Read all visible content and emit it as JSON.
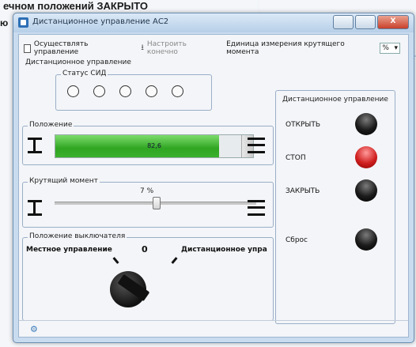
{
  "background": {
    "text": "ечном положений ЗАКРЫТО",
    "text2": "ю"
  },
  "window": {
    "title": "Дистанционное управление АС2",
    "minimize": "",
    "maximize": "",
    "close": "X"
  },
  "toolbar": {
    "connect_label": "Осуществлять управление",
    "configure_label": "Настроить конечно",
    "unit_label": "Единица измерения крутящего момента",
    "unit_value": "%"
  },
  "remote_section_label": "Дистанционное управление",
  "led_status": {
    "label": "Статус СИД",
    "count": 5
  },
  "position": {
    "label": "Положение",
    "value": "82,6",
    "fill_percent": 82.6
  },
  "torque": {
    "label": "Крутящий момент",
    "value": "7 %",
    "slider_percent": 50
  },
  "switch": {
    "label": "Положение выключателя",
    "local": "Местное управление",
    "zero": "0",
    "remote": "Дистанционное упра"
  },
  "right_panel": {
    "title": "Дистанционное управление",
    "open": "ОТКРЫТЬ",
    "stop": "СТОП",
    "close": "ЗАКРЫТЬ",
    "reset": "Сброс",
    "colors": {
      "open": "#1b1b1b",
      "stop": "#d02020",
      "close": "#1b1b1b",
      "reset": "#1b1b1b"
    }
  },
  "colors": {
    "progress_fill": "#3ab12c",
    "window_border": "#6e8fb3"
  }
}
